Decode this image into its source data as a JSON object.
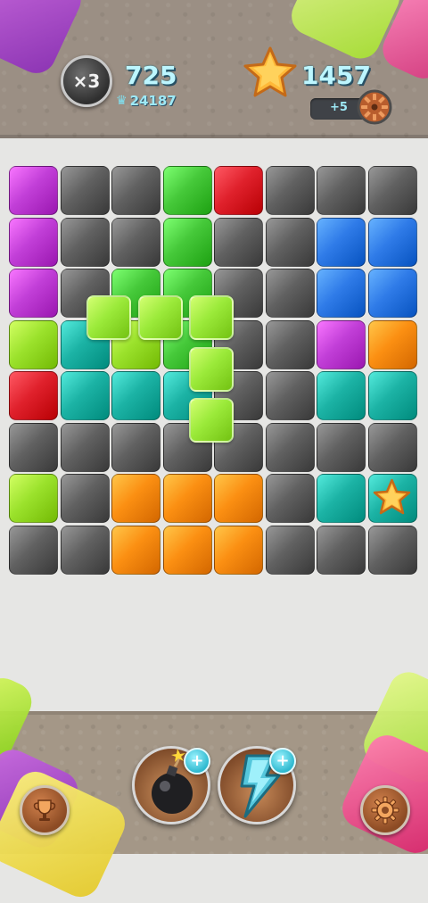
{
  "hud": {
    "multiplier": "×3",
    "score": "725",
    "best": "24187",
    "coins": "1457",
    "gear_count": "5"
  },
  "colors": {
    "purple": "#c23fd8",
    "gray": "#616161",
    "green": "#46c93a",
    "red": "#e0212c",
    "blue": "#2f7be8",
    "lime": "#9be22c",
    "orange": "#fb8f12",
    "teal": "#1cb3a5",
    "piece": "#9bea3a"
  },
  "board": {
    "rows": [
      [
        "purple",
        "gray",
        "gray",
        "green",
        "red",
        "gray",
        "gray",
        "gray"
      ],
      [
        "purple",
        "gray",
        "gray",
        "green",
        "gray",
        "gray",
        "blue",
        "blue"
      ],
      [
        "purple",
        "gray",
        "green",
        "green",
        "gray",
        "gray",
        "blue",
        "blue"
      ],
      [
        "lime",
        "teal",
        "lime",
        "green",
        "gray",
        "gray",
        "purple",
        "orange"
      ],
      [
        "red",
        "teal",
        "teal",
        "teal",
        "gray",
        "gray",
        "teal",
        "teal"
      ],
      [
        "gray",
        "gray",
        "gray",
        "gray",
        "gray",
        "gray",
        "gray",
        "gray"
      ],
      [
        "lime",
        "gray",
        "orange",
        "orange",
        "orange",
        "gray",
        "teal",
        "teal"
      ],
      [
        "gray",
        "gray",
        "orange",
        "orange",
        "orange",
        "gray",
        "gray",
        "gray"
      ]
    ],
    "star_cell": "star at row 7, column 8"
  },
  "piece": {
    "color": "piece",
    "cells": [
      "r0c0",
      "r0c1",
      "r0c2",
      "r1c2",
      "r2c2"
    ]
  },
  "tools": [
    {
      "name": "bomb-icon",
      "plus": "+"
    },
    {
      "name": "lightning-icon",
      "plus": "+"
    }
  ],
  "icons": {
    "star": "star-icon",
    "gear": "gear-icon",
    "trophy": "trophy-icon",
    "crown": "crown-icon"
  }
}
